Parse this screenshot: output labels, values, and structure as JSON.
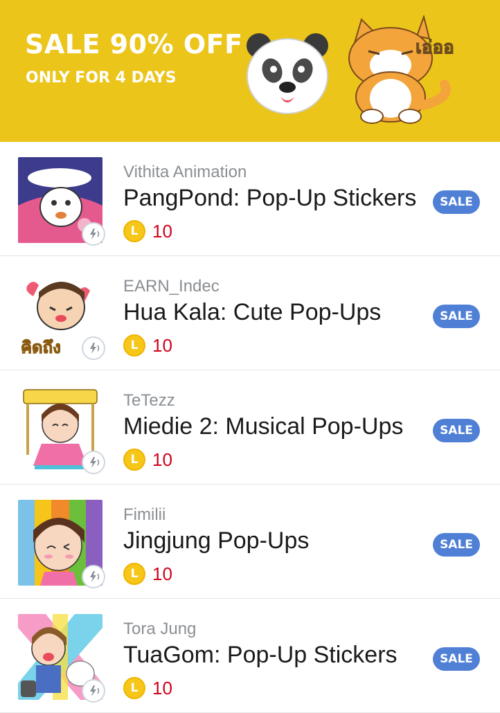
{
  "banner": {
    "title": "SALE 90% OFF",
    "subtitle": "ONLY FOR 4 DAYS",
    "cat_sticker_text": "เอ่ออ"
  },
  "colors": {
    "banner_bg": "#ecc51a",
    "sale_badge": "#4f80d6",
    "price_red": "#d0021b",
    "coin_yellow": "#f6c619"
  },
  "items": [
    {
      "creator": "Vithita Animation",
      "title": "PangPond: Pop-Up Stickers",
      "price": "10",
      "coin_letter": "L",
      "badge": "SALE",
      "icon": "popup-sound-icon"
    },
    {
      "creator": "EARN_Indec",
      "title": "Hua Kala: Cute Pop-Ups",
      "price": "10",
      "coin_letter": "L",
      "badge": "SALE",
      "icon": "popup-sound-icon"
    },
    {
      "creator": "TeTezz",
      "title": "Miedie 2: Musical Pop-Ups",
      "price": "10",
      "coin_letter": "L",
      "badge": "SALE",
      "icon": "popup-sound-icon"
    },
    {
      "creator": "Fimilii",
      "title": "Jingjung Pop-Ups",
      "price": "10",
      "coin_letter": "L",
      "badge": "SALE",
      "icon": "popup-sound-icon"
    },
    {
      "creator": "Tora Jung",
      "title": "TuaGom: Pop-Up Stickers",
      "price": "10",
      "coin_letter": "L",
      "badge": "SALE",
      "icon": "popup-sound-icon"
    }
  ]
}
